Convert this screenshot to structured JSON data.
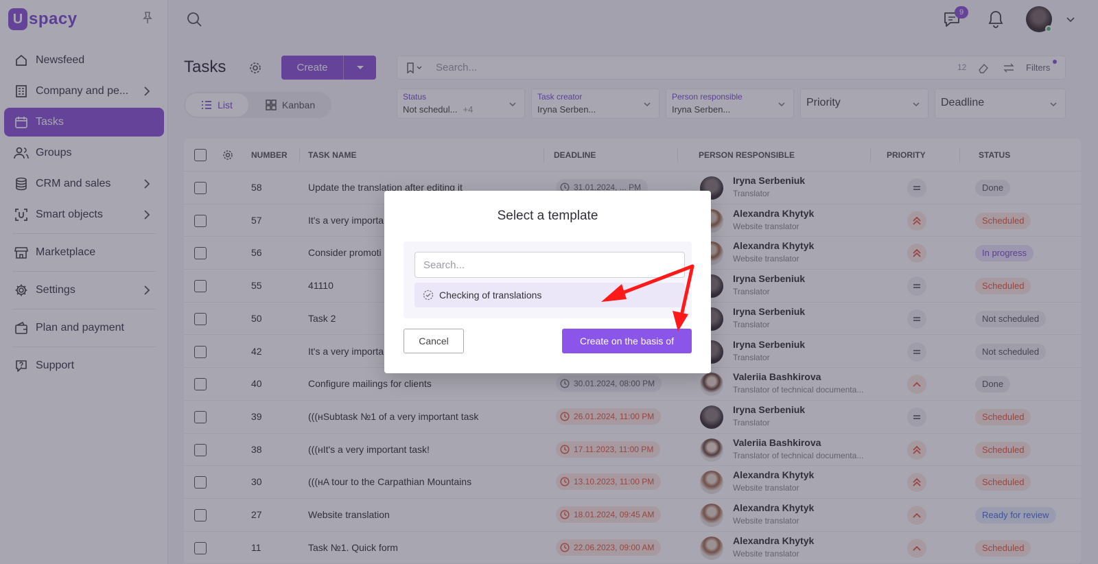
{
  "app": {
    "logo_mark": "U",
    "logo_text": "spacy"
  },
  "sidebar": {
    "items": [
      {
        "label": "Newsfeed",
        "icon": "home-icon"
      },
      {
        "label": "Company and pe...",
        "icon": "building-icon",
        "has_arrow": true
      },
      {
        "label": "Tasks",
        "icon": "calendar-icon",
        "active": true
      },
      {
        "label": "Groups",
        "icon": "users-icon"
      },
      {
        "label": "CRM and sales",
        "icon": "database-icon",
        "has_arrow": true
      },
      {
        "label": "Smart objects",
        "icon": "smart-object-icon",
        "has_arrow": true
      },
      {
        "label": "Marketplace",
        "icon": "store-icon"
      },
      {
        "label": "Settings",
        "icon": "gear-icon",
        "has_arrow": true
      },
      {
        "label": "Plan and payment",
        "icon": "wallet-icon"
      },
      {
        "label": "Support",
        "icon": "help-icon"
      }
    ]
  },
  "topbar": {
    "chat_badge": "9"
  },
  "page": {
    "title": "Tasks",
    "create_label": "Create",
    "search_placeholder": "Search...",
    "count": "12",
    "filters_label": "Filters",
    "view_list": "List",
    "view_kanban": "Kanban"
  },
  "filters": {
    "status": {
      "caption": "Status",
      "value": "Not schedul...",
      "more": "+4"
    },
    "creator": {
      "caption": "Task creator",
      "value": "Iryna Serben..."
    },
    "responsible": {
      "caption": "Person responsible",
      "value": "Iryna Serben..."
    },
    "priority": {
      "label": "Priority"
    },
    "deadline": {
      "label": "Deadline"
    }
  },
  "table": {
    "columns": {
      "number": "NUMBER",
      "task_name": "TASK NAME",
      "deadline": "DEADLINE",
      "person": "PERSON RESPONSIBLE",
      "priority": "PRIORITY",
      "status": "STATUS"
    },
    "rows": [
      {
        "num": "58",
        "name": "Update the translation after editing it",
        "deadline": "31.01.2024, ... PM",
        "dl_style": "gray",
        "person": "Iryna Serbeniuk",
        "role": "Translator",
        "avatar": "iryna",
        "priority": "eq",
        "status": "Done",
        "status_style": "done"
      },
      {
        "num": "57",
        "name": "It's a very importa",
        "deadline": "",
        "dl_style": "red",
        "person": "Alexandra Khytyk",
        "role": "Website translator",
        "avatar": "alex",
        "priority": "high",
        "status": "Scheduled",
        "status_style": "scheduled"
      },
      {
        "num": "56",
        "name": "Consider promoti",
        "deadline": "",
        "dl_style": "red",
        "person": "Alexandra Khytyk",
        "role": "Website translator",
        "avatar": "alex",
        "priority": "high",
        "status": "In progress",
        "status_style": "progress"
      },
      {
        "num": "55",
        "name": "41110",
        "deadline": "",
        "dl_style": "red",
        "person": "Iryna Serbeniuk",
        "role": "Translator",
        "avatar": "iryna",
        "priority": "eq",
        "status": "Scheduled",
        "status_style": "scheduled"
      },
      {
        "num": "50",
        "name": "Task 2",
        "deadline": "",
        "dl_style": "gray",
        "person": "Iryna Serbeniuk",
        "role": "Translator",
        "avatar": "iryna",
        "priority": "eq",
        "status": "Not scheduled",
        "status_style": "notsch"
      },
      {
        "num": "42",
        "name": "It's a very importa",
        "deadline": "",
        "dl_style": "gray",
        "person": "Iryna Serbeniuk",
        "role": "Translator",
        "avatar": "iryna",
        "priority": "eq",
        "status": "Not scheduled",
        "status_style": "notsch"
      },
      {
        "num": "40",
        "name": "Configure mailings for clients",
        "deadline": "30.01.2024, 08:00 PM",
        "dl_style": "gray",
        "person": "Valeriia Bashkirova",
        "role": "Translator of technical documenta...",
        "avatar": "val",
        "priority": "up",
        "status": "Done",
        "status_style": "done"
      },
      {
        "num": "39",
        "name": "(((нSubtask №1 of a very important task",
        "deadline": "26.01.2024, 11:00 PM",
        "dl_style": "red",
        "person": "Iryna Serbeniuk",
        "role": "Translator",
        "avatar": "iryna",
        "priority": "eq",
        "status": "Scheduled",
        "status_style": "scheduled"
      },
      {
        "num": "38",
        "name": "(((нIt's a very important task!",
        "deadline": "17.11.2023, 11:00 PM",
        "dl_style": "red",
        "person": "Valeriia Bashkirova",
        "role": "Translator of technical documenta...",
        "avatar": "val",
        "priority": "high",
        "status": "Scheduled",
        "status_style": "scheduled"
      },
      {
        "num": "30",
        "name": "(((нA tour to the Carpathian Mountains",
        "deadline": "13.10.2023, 11:00 PM",
        "dl_style": "red",
        "person": "Alexandra Khytyk",
        "role": "Website translator",
        "avatar": "alex",
        "priority": "high",
        "status": "Scheduled",
        "status_style": "scheduled"
      },
      {
        "num": "27",
        "name": "Website translation",
        "deadline": "18.01.2024, 09:45 AM",
        "dl_style": "red",
        "person": "Alexandra Khytyk",
        "role": "Website translator",
        "avatar": "alex",
        "priority": "up",
        "status": "Ready for review",
        "status_style": "review"
      },
      {
        "num": "11",
        "name": "Task №1. Quick form",
        "deadline": "22.06.2023, 09:00 AM",
        "dl_style": "red",
        "person": "Alexandra Khytyk",
        "role": "Website translator",
        "avatar": "alex",
        "priority": "up",
        "status": "Scheduled",
        "status_style": "scheduled"
      }
    ]
  },
  "modal": {
    "title": "Select a template",
    "search_placeholder": "Search...",
    "template_item": "Checking of translations",
    "cancel_label": "Cancel",
    "create_label": "Create on the basis of"
  },
  "colors": {
    "accent": "#8a55d8",
    "arrow": "#ff1a1a",
    "overdue": "#e25a3d"
  }
}
